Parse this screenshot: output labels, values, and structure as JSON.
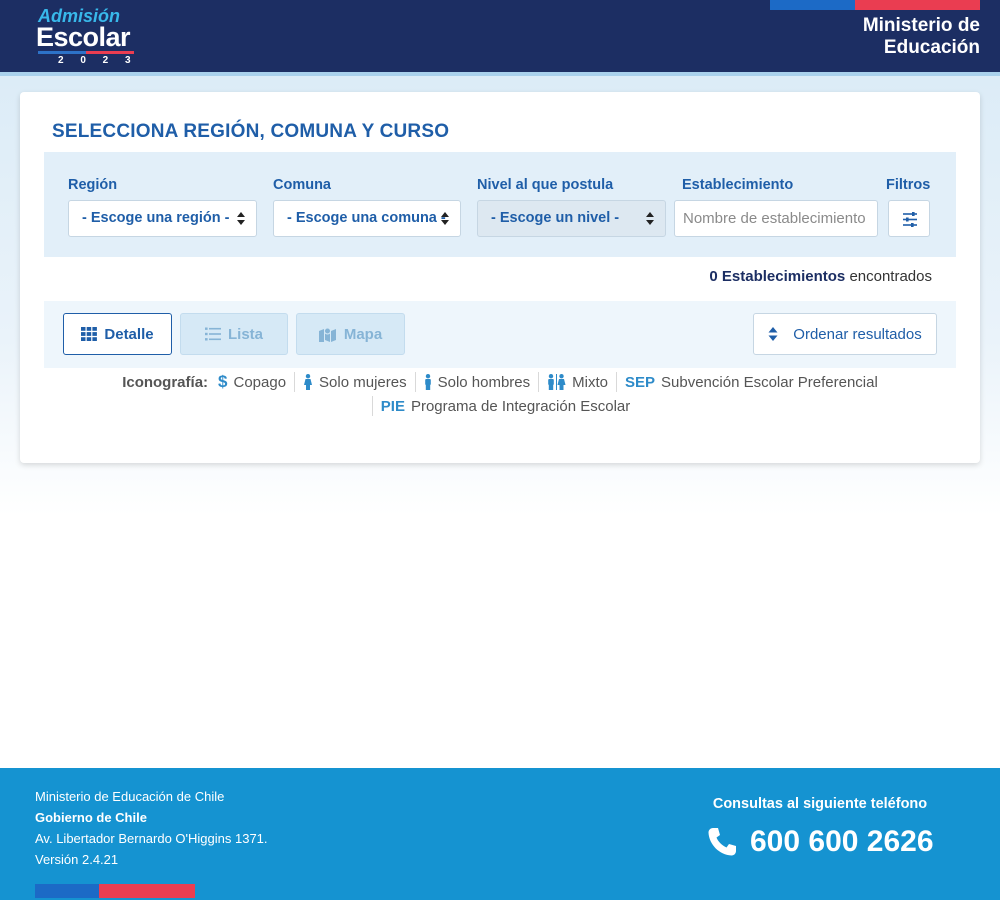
{
  "header": {
    "logo_line1": "Admisión",
    "logo_line2": "Escolar",
    "logo_year": "2 0 2 3",
    "ministry": "Ministerio de Educación"
  },
  "card": {
    "title": "SELECCIONA REGIÓN, COMUNA Y CURSO",
    "filters": {
      "region_label": "Región",
      "region_value": "- Escoge una región -",
      "comuna_label": "Comuna",
      "comuna_value": "- Escoge una comuna -",
      "nivel_label": "Nivel al que postula",
      "nivel_value": "- Escoge un nivel -",
      "establecimiento_label": "Establecimiento",
      "establecimiento_placeholder": "Nombre de establecimiento",
      "filtros_label": "Filtros"
    },
    "results": {
      "count_text": "0 Establecimientos",
      "suffix": "encontrados"
    },
    "views": {
      "detalle": "Detalle",
      "lista": "Lista",
      "mapa": "Mapa",
      "ordenar": "Ordenar resultados"
    },
    "legend": {
      "title": "Iconografía:",
      "copago_symbol": "$",
      "copago": "Copago",
      "mujeres": "Solo mujeres",
      "hombres": "Solo hombres",
      "mixto": "Mixto",
      "sep_code": "SEP",
      "sep": "Subvención Escolar Preferencial",
      "pie_code": "PIE",
      "pie": "Programa de Integración Escolar"
    }
  },
  "footer": {
    "line1": "Ministerio de Educación de Chile",
    "line2": "Gobierno de Chile",
    "line3": "Av. Libertador Bernardo O'Higgins 1371.",
    "line4": "Versión 2.4.21",
    "consultas": "Consultas al siguiente teléfono",
    "phone": "600 600 2626"
  },
  "colors": {
    "header_bg": "#1c2e63",
    "accent_blue": "#1f5ea8",
    "footer_bg": "#1593d1",
    "flag_red": "#ea3d51"
  }
}
